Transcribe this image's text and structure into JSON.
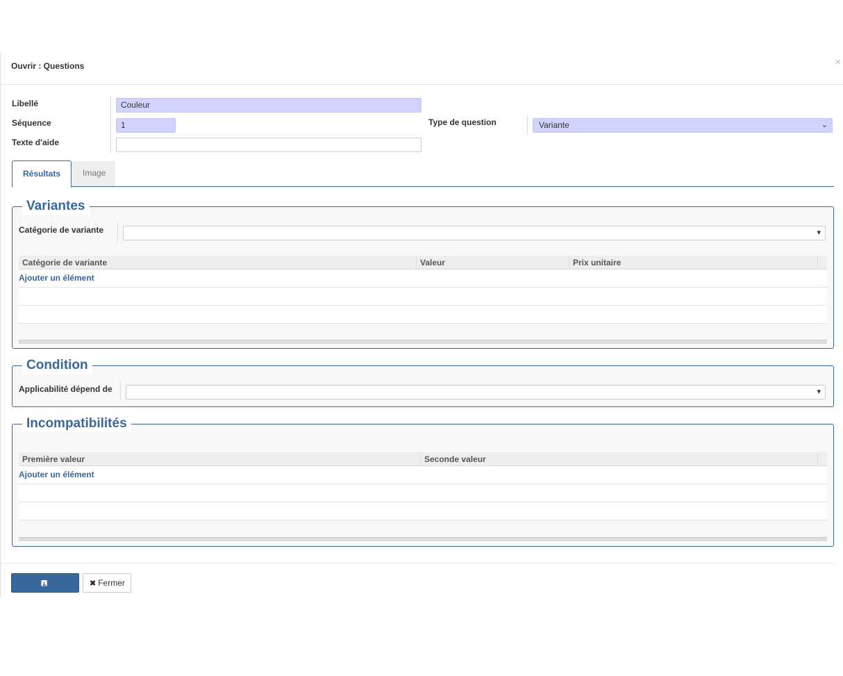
{
  "modal": {
    "title": "Ouvrir : Questions",
    "close_glyph": "×"
  },
  "form": {
    "libelle_label": "Libellé",
    "libelle_value": "Couleur",
    "sequence_label": "Séquence",
    "sequence_value": "1",
    "texte_aide_label": "Texte d'aide",
    "texte_aide_value": "",
    "type_question_label": "Type de question",
    "type_question_value": "Variante"
  },
  "tabs": [
    {
      "label": "Résultats",
      "active": true
    },
    {
      "label": "Image",
      "active": false
    }
  ],
  "variantes": {
    "legend": "Variantes",
    "categorie_label": "Catégorie de variante",
    "categorie_value": "",
    "columns": [
      "Catégorie de variante",
      "Valeur",
      "Prix unitaire"
    ],
    "add_label": "Ajouter un élément"
  },
  "condition": {
    "legend": "Condition",
    "applicabilite_label": "Applicabilité dépend de",
    "applicabilite_value": ""
  },
  "incompatibilites": {
    "legend": "Incompatibilités",
    "columns": [
      "Première valeur",
      "Seconde valeur"
    ],
    "add_label": "Ajouter un élément"
  },
  "footer": {
    "save_label": "Sauvegarder",
    "close_label": "Fermer",
    "save_icon": "floppy-disk-icon",
    "close_icon": "times-icon"
  }
}
